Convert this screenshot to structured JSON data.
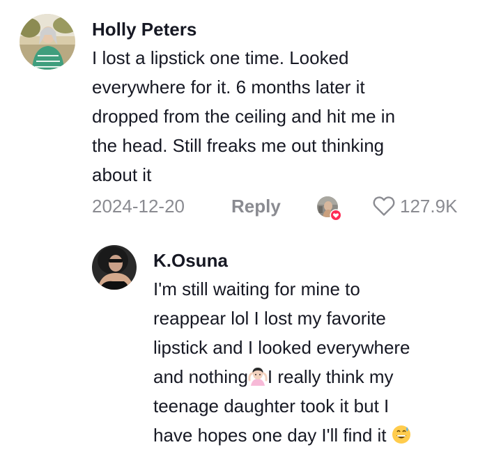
{
  "comment": {
    "username": "Holly Peters",
    "text_lines": [
      "I lost a lipstick one time. Looked",
      "everywhere for it. 6 months later it",
      "dropped from the ceiling and hit me in",
      "the head. Still freaks me out thinking",
      "about it"
    ],
    "date": "2024-12-20",
    "reply_label": "Reply",
    "like_count": "127.9K"
  },
  "reply": {
    "username": "K.Osuna",
    "text_lines": [
      "I'm still waiting for mine to",
      "reappear lol I lost my favorite",
      "lipstick and I looked everywhere",
      "and nothing",
      "I really think my",
      "teenage daughter took it but I",
      "have hopes one day I'll find it"
    ],
    "emoji_shrug": "🤷🏻‍♀️",
    "emoji_sweat_smile": "😅"
  },
  "colors": {
    "text": "#161823",
    "muted": "#8a8b91",
    "like_badge": "#fe2c55"
  },
  "icons": {
    "like": "heart-outline-icon",
    "liked_badge": "heart-badge-icon"
  }
}
